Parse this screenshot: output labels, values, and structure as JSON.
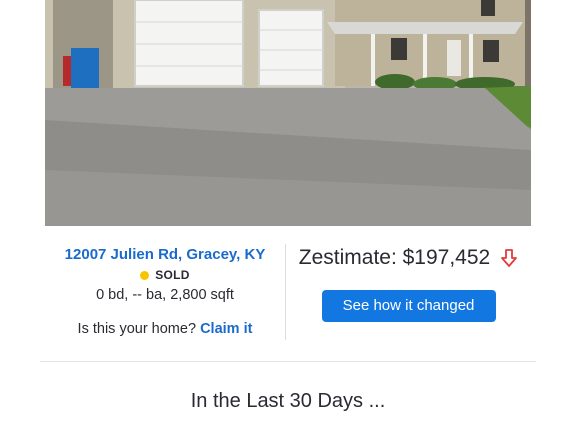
{
  "listing": {
    "address": "12007 Julien Rd, Gracey, KY",
    "status": "SOLD",
    "status_color": "#f7c500",
    "facts": "0 bd, -- ba, 2,800 sqft",
    "claim_prompt": "Is this your home?",
    "claim_link": "Claim it"
  },
  "zestimate": {
    "label": "Zestimate: $197,452",
    "trend_icon": "arrow-down-icon",
    "trend_color": "#e23b3b"
  },
  "cta": {
    "label": "See how it changed"
  },
  "section": {
    "heading": "In the Last 30 Days ..."
  },
  "colors": {
    "link": "#1a6bcc",
    "button": "#1277e1",
    "text": "#2a2a33"
  }
}
